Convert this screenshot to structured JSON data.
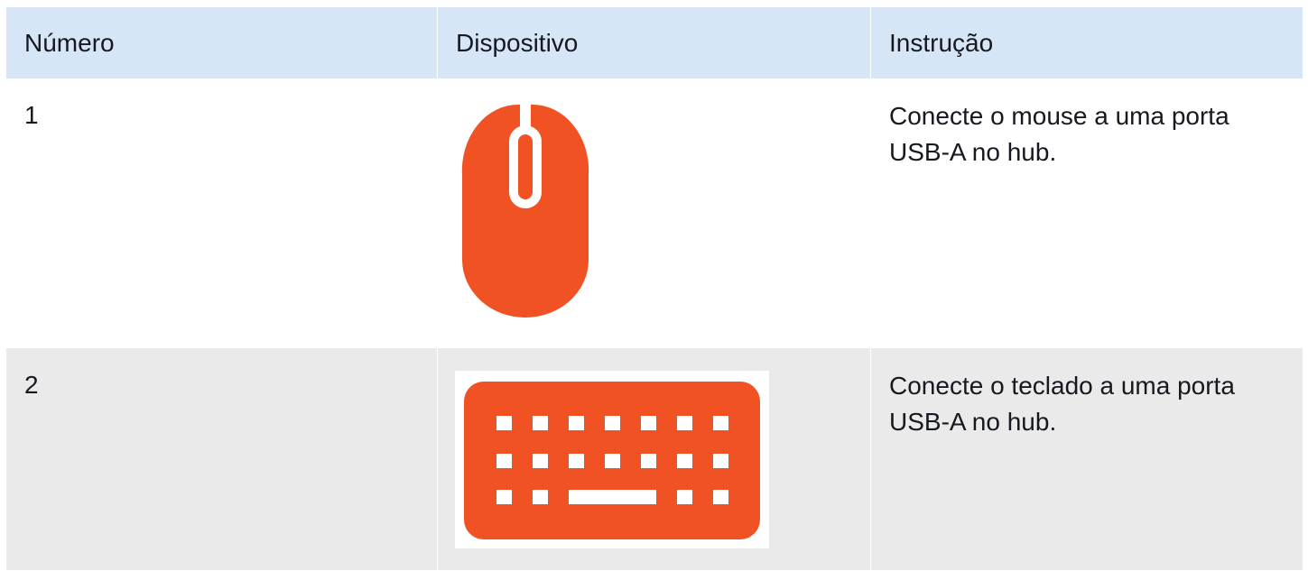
{
  "table": {
    "headers": {
      "number": "Número",
      "device": "Dispositivo",
      "instruction": "Instrução"
    },
    "rows": [
      {
        "number": "1",
        "device_icon": "mouse-icon",
        "instruction": "Conecte o mouse a uma porta USB-A no hub."
      },
      {
        "number": "2",
        "device_icon": "keyboard-icon",
        "instruction": "Conecte o teclado a uma porta USB-A no hub."
      }
    ]
  },
  "colors": {
    "header_background": "#d6e6f6",
    "alt_row_background": "#eaeaeb",
    "icon_color": "#f05223",
    "text_color": "#16191f"
  }
}
